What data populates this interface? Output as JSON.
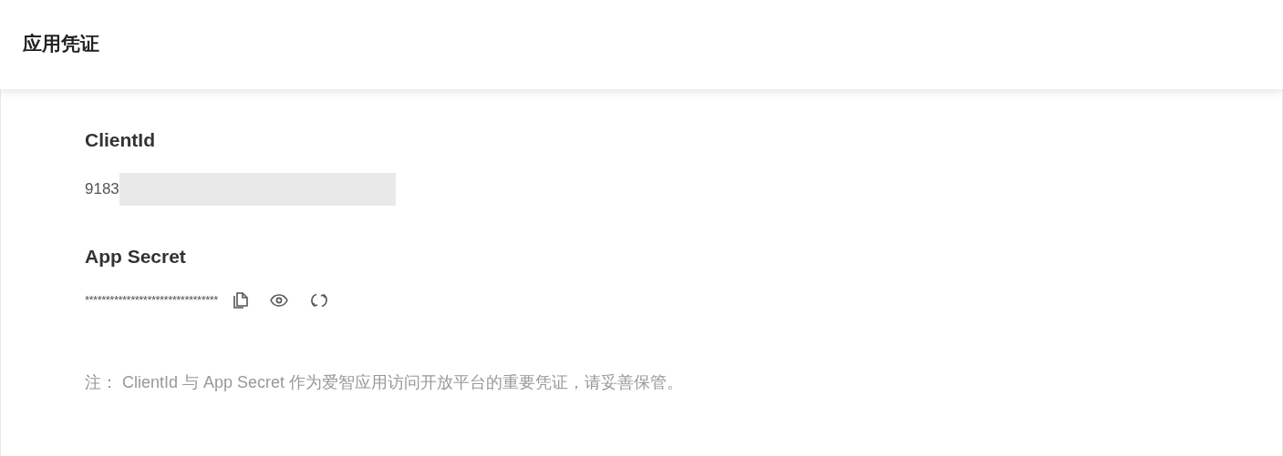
{
  "header": {
    "title": "应用凭证"
  },
  "client_id": {
    "label": "ClientId",
    "value": "9183"
  },
  "app_secret": {
    "label": "App Secret",
    "value": "********************************"
  },
  "note": "注： ClientId 与 App Secret 作为爱智应用访问开放平台的重要凭证，请妥善保管。"
}
